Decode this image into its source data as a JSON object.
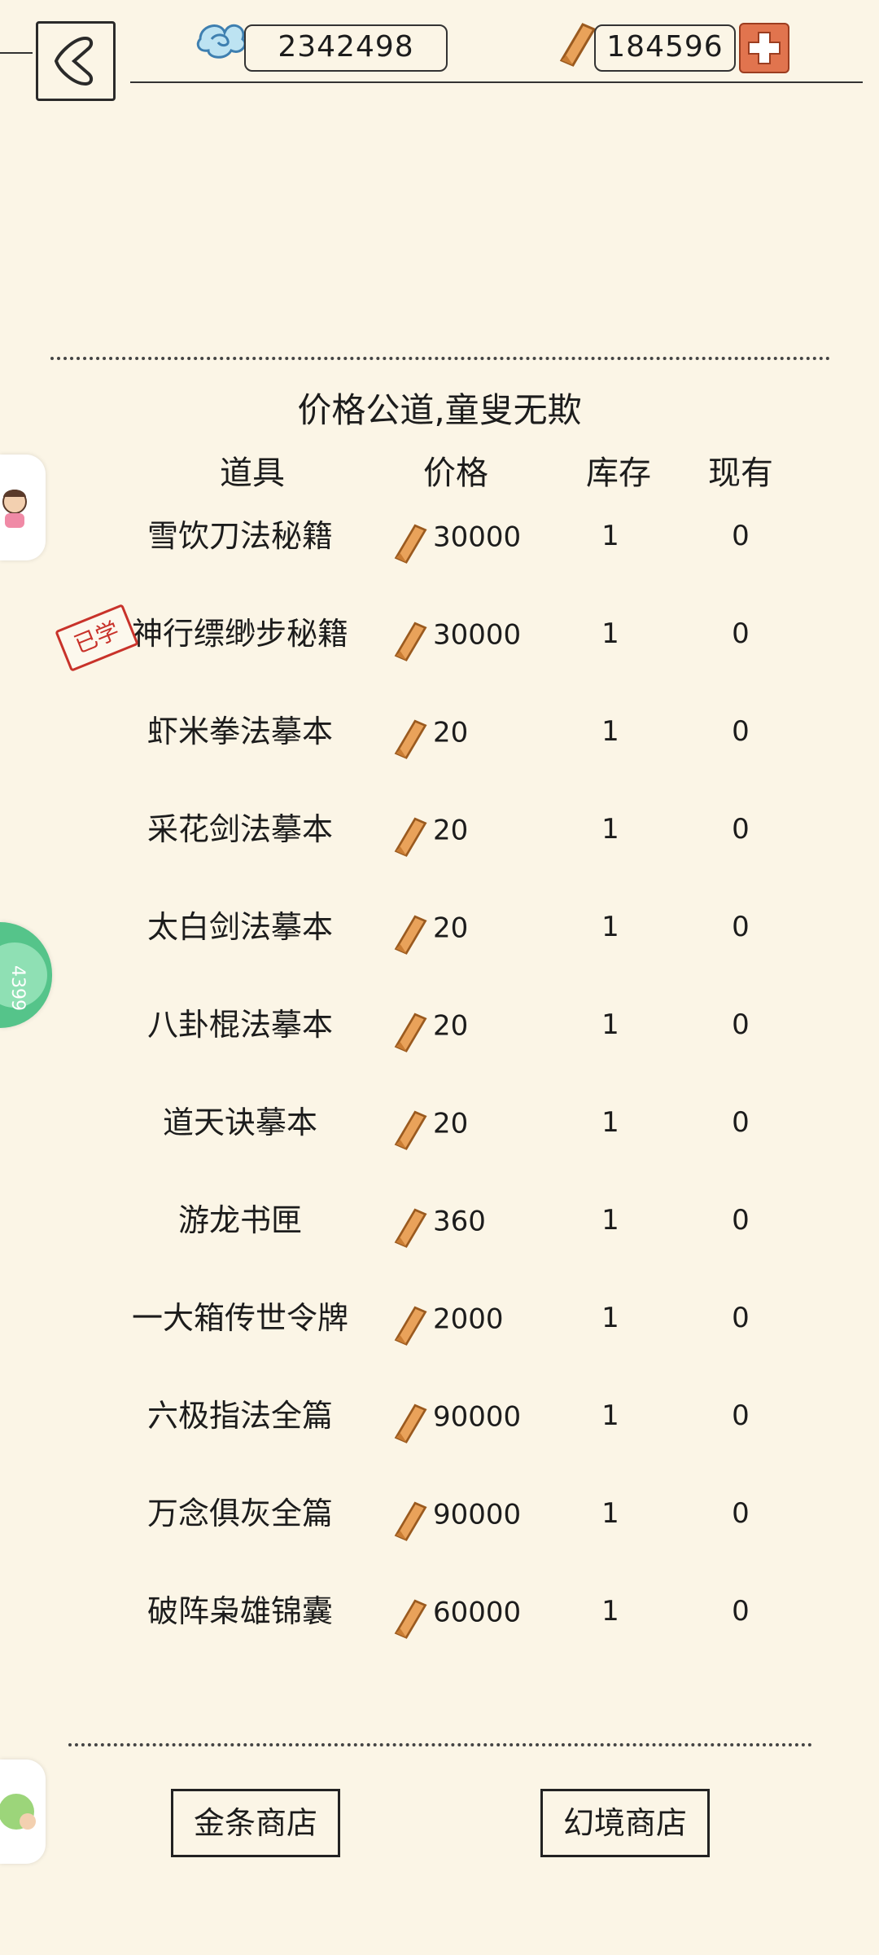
{
  "topbar": {
    "silver": "2342498",
    "gold": "184596"
  },
  "shop": {
    "slogan": "价格公道,童叟无欺",
    "columns": {
      "item": "道具",
      "price": "价格",
      "stock": "库存",
      "owned": "现有"
    },
    "learned_stamp": "已学",
    "rows": [
      {
        "name": "雪饮刀法秘籍",
        "price": "30000",
        "stock": "1",
        "owned": "0"
      },
      {
        "name": "神行缥缈步秘籍",
        "price": "30000",
        "stock": "1",
        "owned": "0"
      },
      {
        "name": "虾米拳法摹本",
        "price": "20",
        "stock": "1",
        "owned": "0"
      },
      {
        "name": "采花剑法摹本",
        "price": "20",
        "stock": "1",
        "owned": "0"
      },
      {
        "name": "太白剑法摹本",
        "price": "20",
        "stock": "1",
        "owned": "0"
      },
      {
        "name": "八卦棍法摹本",
        "price": "20",
        "stock": "1",
        "owned": "0"
      },
      {
        "name": "道天诀摹本",
        "price": "20",
        "stock": "1",
        "owned": "0"
      },
      {
        "name": "游龙书匣",
        "price": "360",
        "stock": "1",
        "owned": "0"
      },
      {
        "name": "一大箱传世令牌",
        "price": "2000",
        "stock": "1",
        "owned": "0"
      },
      {
        "name": "六极指法全篇",
        "price": "90000",
        "stock": "1",
        "owned": "0"
      },
      {
        "name": "万念俱灰全篇",
        "price": "90000",
        "stock": "1",
        "owned": "0"
      },
      {
        "name": "破阵枭雄锦囊",
        "price": "60000",
        "stock": "1",
        "owned": "0"
      }
    ]
  },
  "bottom": {
    "gold_shop": "金条商店",
    "dream_shop": "幻境商店"
  },
  "colors": {
    "background": "#fbf5e6",
    "gold_bar": "#e9a25a",
    "plus_button": "#e1744e",
    "stamp": "#c8322a"
  },
  "icons": [
    "back-arrow-icon",
    "cloud-icon",
    "gold-bar-icon",
    "plus-icon"
  ]
}
